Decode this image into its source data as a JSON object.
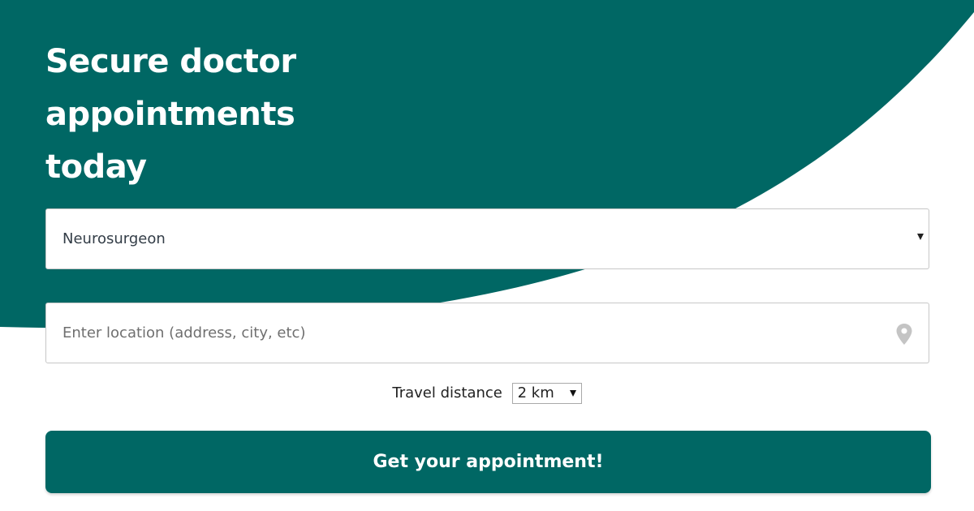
{
  "colors": {
    "brand": "#006764",
    "background": "#ffffff",
    "field_border": "#c7c7c7",
    "icon_gray": "#c4c4c4"
  },
  "hero": {
    "title_lines": [
      "Secure doctor",
      "appointments",
      "today"
    ]
  },
  "form": {
    "specialty": {
      "selected_value": "Neurosurgeon",
      "icon": "chevron-down-icon"
    },
    "location": {
      "placeholder": "Enter location (address, city, etc)",
      "value": "",
      "icon": "map-pin-icon"
    },
    "travel_distance": {
      "label": "Travel distance",
      "selected_value": "2 km",
      "icon": "chevron-down-icon"
    },
    "submit_label": "Get your appointment!"
  }
}
